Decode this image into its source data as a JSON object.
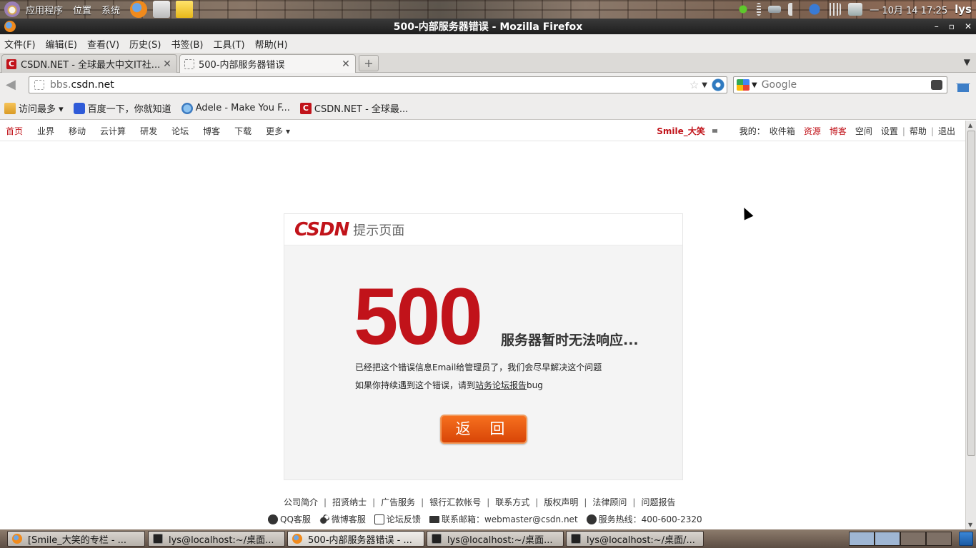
{
  "top_panel": {
    "menus": [
      "应用程序",
      "位置",
      "系统"
    ],
    "clock": "一 10月 14 17:25",
    "user": "lys"
  },
  "window": {
    "title": "500-内部服务器错误 - Mozilla Firefox",
    "controls": [
      "–",
      "▫",
      "✕"
    ]
  },
  "menubar": {
    "items": [
      "文件(F)",
      "编辑(E)",
      "查看(V)",
      "历史(S)",
      "书签(B)",
      "工具(T)",
      "帮助(H)"
    ]
  },
  "tabs": [
    {
      "label": "CSDN.NET - 全球最大中文IT社...",
      "active": false
    },
    {
      "label": "500-内部服务器错误",
      "active": true
    }
  ],
  "new_tab": "+",
  "navbar": {
    "url_dim": "bbs.",
    "url_main": "csdn.net",
    "search_placeholder": "Google"
  },
  "bookmarks": [
    {
      "label": "访问最多 ▾",
      "icon": "folder-icon"
    },
    {
      "label": "百度一下，你就知道",
      "icon": "baidu-icon"
    },
    {
      "label": "Adele - Make You F...",
      "icon": "adele-icon"
    },
    {
      "label": "CSDN.NET - 全球最...",
      "icon": "csdn-icon"
    }
  ],
  "site_nav": {
    "left": [
      "首页",
      "业界",
      "移动",
      "云计算",
      "研发",
      "论坛",
      "博客",
      "下载",
      "更多 ▾"
    ],
    "username": "Smile_大笑",
    "mine_label": "我的：",
    "right": [
      "收件箱",
      "资源",
      "博客",
      "空间",
      "设置",
      "帮助",
      "退出"
    ]
  },
  "error_card": {
    "logo": "CSDN",
    "logo_sub": "提示页面",
    "code": "500",
    "headline": "服务器暂时无法响应...",
    "message1": "已经把这个错误信息Email给管理员了，我们会尽早解决这个问题",
    "message2_pre": "如果你持续遇到这个错误，请到",
    "message2_link": "站务论坛报告",
    "message2_post": "bug",
    "back_label": "返 回"
  },
  "footer": {
    "links": [
      "公司简介",
      "招贤纳士",
      "广告服务",
      "银行汇款帐号",
      "联系方式",
      "版权声明",
      "法律顾问",
      "问题报告"
    ],
    "qq": "QQ客服",
    "weibo": "微博客服",
    "forum": "论坛反馈",
    "email": "联系邮箱：webmaster@csdn.net",
    "hotline": "服务热线：400-600-2320"
  },
  "taskbar": [
    {
      "label": "[Smile_大笑的专栏 - ...",
      "icon": "firefox-icon",
      "active": false
    },
    {
      "label": "lys@localhost:~/桌面...",
      "icon": "terminal-icon",
      "active": false
    },
    {
      "label": "500-内部服务器错误 - ...",
      "icon": "firefox-icon",
      "active": true
    },
    {
      "label": "lys@localhost:~/桌面...",
      "icon": "terminal-icon",
      "active": false
    },
    {
      "label": "lys@localhost:~/桌面/...",
      "icon": "terminal-icon",
      "active": false
    }
  ]
}
